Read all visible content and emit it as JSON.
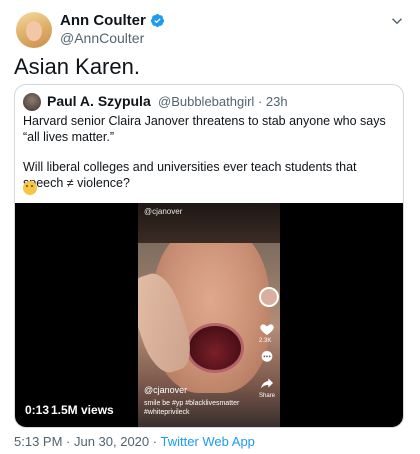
{
  "author": {
    "name": "Ann Coulter",
    "handle": "@AnnCoulter",
    "verified": true
  },
  "tweet": {
    "text": "Asian Karen.",
    "date": "5:13 PM · Jun 30, 2020",
    "separator": " · ",
    "source": "Twitter Web App"
  },
  "quoted": {
    "name": "Paul A. Szypula",
    "handle": "@Bubblebathgirl",
    "time": "23h",
    "meta_sep": " · ",
    "paragraph1": "Harvard senior Claira Janover threatens to stab anyone who says “all lives matter.”",
    "paragraph2": "Will liberal colleges and universities ever teach students that speech ≠ violence?",
    "emoji": "thinking-face-emoji"
  },
  "video": {
    "duration": "0:13",
    "views": "1.5M views",
    "overlay_user": "@cjanover",
    "overlay_handle": "@cjanover",
    "overlay_caption": "smile be #yp #blacklivesmatter #whiteprivileck",
    "like_count": "2.3K",
    "share_label": "Share"
  },
  "colors": {
    "accent": "#1d9bf0",
    "muted": "#536471",
    "border": "#cfd9de"
  }
}
